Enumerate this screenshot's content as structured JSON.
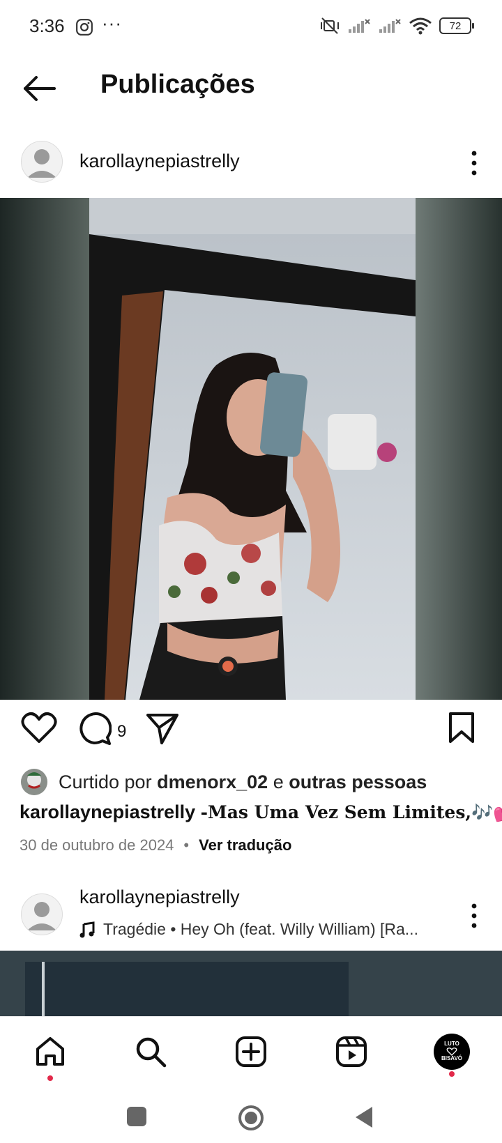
{
  "status_bar": {
    "time": "3:36",
    "battery": "72"
  },
  "header": {
    "title": "Publicações"
  },
  "post1": {
    "username": "karollaynepiastrelly",
    "comment_count": "9",
    "likes_prefix": "Curtido por",
    "likes_user": "dmenorx_02",
    "likes_conj": "e",
    "likes_others": "outras pessoas",
    "caption_user": "karollaynepiastrelly",
    "caption_text": "-Mas Uma Vez Sem Limites,🎶💕",
    "date": "30 de outubro de 2024",
    "separator": "•",
    "translate_label": "Ver tradução"
  },
  "post2": {
    "username": "karollaynepiastrelly",
    "music": "Tragédie • Hey Oh (feat. Willy William) [Ra..."
  },
  "bottom_nav": {
    "profile_badge_line1": "LUTO",
    "profile_badge_line2": "BISAVÓ"
  }
}
